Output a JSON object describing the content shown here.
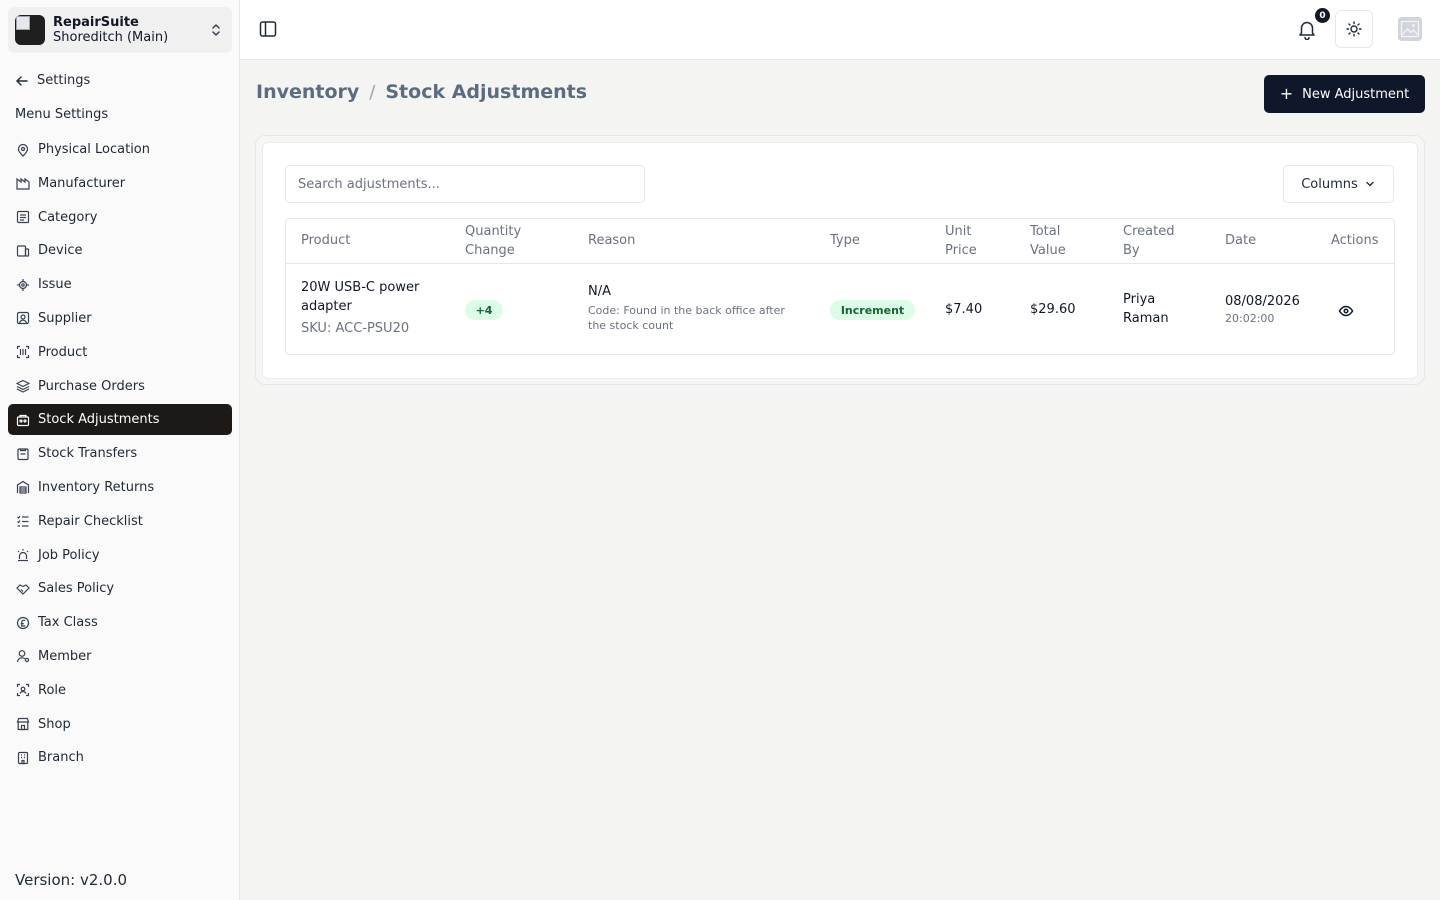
{
  "app": {
    "name": "RepairSuite",
    "branch": "Shoreditch (Main)",
    "version": "Version: v2.0.0"
  },
  "sidebar": {
    "back_label": "Settings",
    "section_label": "Menu Settings",
    "items": [
      {
        "label": "Physical Location",
        "icon": "location-icon"
      },
      {
        "label": "Manufacturer",
        "icon": "factory-icon"
      },
      {
        "label": "Category",
        "icon": "category-icon"
      },
      {
        "label": "Device",
        "icon": "device-icon"
      },
      {
        "label": "Issue",
        "icon": "bug-icon"
      },
      {
        "label": "Supplier",
        "icon": "supplier-icon"
      },
      {
        "label": "Product",
        "icon": "barcode-icon"
      },
      {
        "label": "Purchase Orders",
        "icon": "layers-icon"
      },
      {
        "label": "Stock Adjustments",
        "icon": "adjust-icon",
        "active": true
      },
      {
        "label": "Stock Transfers",
        "icon": "transfer-icon"
      },
      {
        "label": "Inventory Returns",
        "icon": "warehouse-icon"
      },
      {
        "label": "Repair Checklist",
        "icon": "checklist-icon"
      },
      {
        "label": "Job Policy",
        "icon": "siren-icon"
      },
      {
        "label": "Sales Policy",
        "icon": "handshake-icon"
      },
      {
        "label": "Tax Class",
        "icon": "currency-icon"
      },
      {
        "label": "Member",
        "icon": "user-icon"
      },
      {
        "label": "Role",
        "icon": "role-icon"
      },
      {
        "label": "Shop",
        "icon": "store-icon"
      },
      {
        "label": "Branch",
        "icon": "building-icon"
      }
    ]
  },
  "topbar": {
    "notification_count": "0"
  },
  "header": {
    "breadcrumb_parent": "Inventory",
    "breadcrumb_separator": "/",
    "breadcrumb_current": "Stock Adjustments",
    "new_button_label": "New Adjustment"
  },
  "toolbar": {
    "search_placeholder": "Search adjustments...",
    "columns_label": "Columns"
  },
  "table": {
    "headers": {
      "product": "Product",
      "quantity_line1": "Quantity",
      "quantity_line2": "Change",
      "reason": "Reason",
      "type": "Type",
      "unit_line1": "Unit",
      "unit_line2": "Price",
      "total_line1": "Total",
      "total_line2": "Value",
      "created_line1": "Created",
      "created_line2": "By",
      "date": "Date",
      "actions": "Actions"
    },
    "rows": [
      {
        "product_line1": "20W USB-C power",
        "product_line2": "adapter",
        "sku": "SKU: ACC-PSU20",
        "quantity_change": "+4",
        "reason": "N/A",
        "reason_code_line1": "Code: Found in the back office after",
        "reason_code_line2": "the stock count",
        "type": "Increment",
        "unit_price": "$7.40",
        "total_value": "$29.60",
        "created_by_line1": "Priya",
        "created_by_line2": "Raman",
        "date": "08/08/2026",
        "time": "20:02:00"
      }
    ]
  },
  "colors": {
    "accent": "#0f172a",
    "active_nav": "#1c1917",
    "badge_bg": "#dcfce7",
    "badge_text": "#166534"
  }
}
